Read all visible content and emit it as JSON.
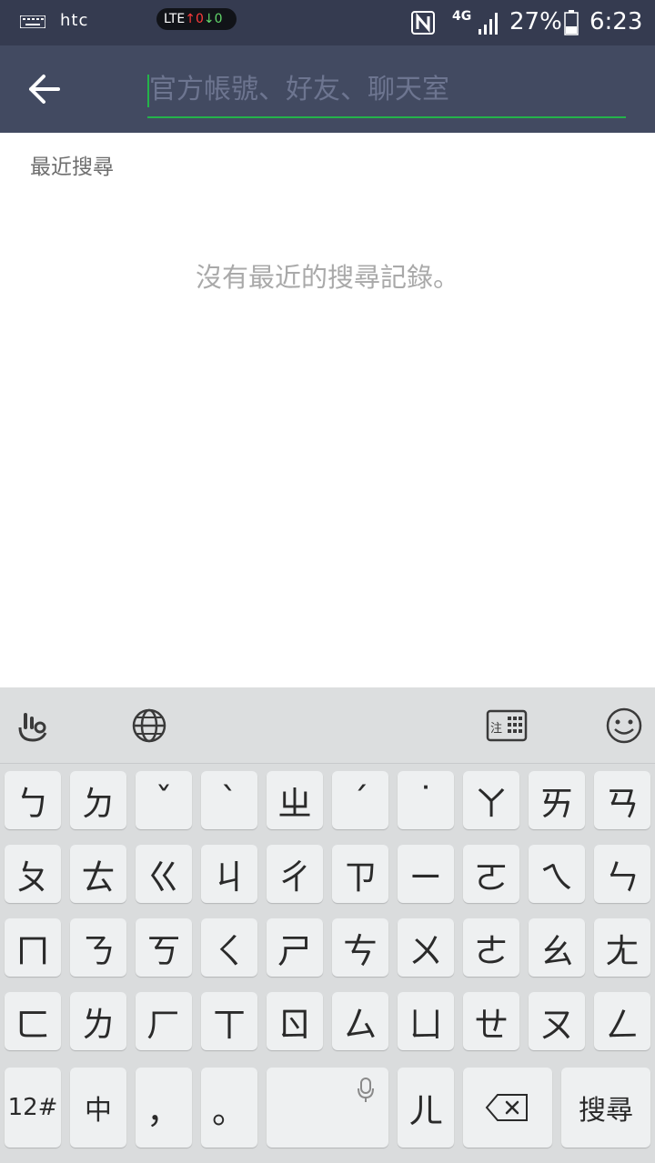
{
  "status_bar": {
    "brand": "htc",
    "lte_label": "LTE",
    "lte_up": "↑0",
    "lte_down": "↓0",
    "network_type": "4G",
    "battery_percent": "27%",
    "time": "6:23",
    "icons": [
      "keyboard-icon",
      "nfc-icon",
      "signal-icon",
      "battery-icon"
    ]
  },
  "header": {
    "back_icon": "arrow-left-icon",
    "search_value": "",
    "search_placeholder": "官方帳號、好友、聊天室",
    "accent_color": "#24b34a",
    "background_color": "#424a61"
  },
  "content": {
    "recent_title": "最近搜尋",
    "empty_message": "沒有最近的搜尋記錄。"
  },
  "keyboard": {
    "toolbar": [
      "touchpal-icon",
      "globe-icon",
      "zhuyin-layout-icon",
      "emoji-icon"
    ],
    "layout_label": "注",
    "rows": [
      [
        "ㄅ",
        "ㄉ",
        "ˇ",
        "ˋ",
        "ㄓ",
        "ˊ",
        "˙",
        "ㄚ",
        "ㄞ",
        "ㄢ"
      ],
      [
        "ㄆ",
        "ㄊ",
        "ㄍ",
        "ㄐ",
        "ㄔ",
        "ㄗ",
        "ㄧ",
        "ㄛ",
        "ㄟ",
        "ㄣ"
      ],
      [
        "ㄇ",
        "ㄋ",
        "ㄎ",
        "ㄑ",
        "ㄕ",
        "ㄘ",
        "ㄨ",
        "ㄜ",
        "ㄠ",
        "ㄤ"
      ],
      [
        "ㄈ",
        "ㄌ",
        "ㄏ",
        "ㄒ",
        "ㄖ",
        "ㄙ",
        "ㄩ",
        "ㄝ",
        "ㄡ",
        "ㄥ"
      ]
    ],
    "bottom": {
      "numbers": "12#",
      "lang": "中",
      "comma": "，",
      "period": "。",
      "er": "ㄦ",
      "search": "搜尋"
    }
  }
}
